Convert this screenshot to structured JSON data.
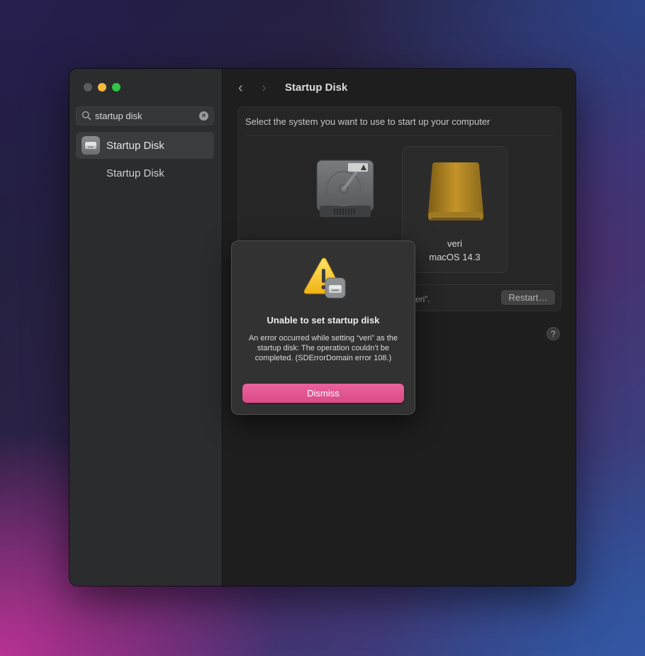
{
  "window": {
    "search": {
      "value": "startup disk"
    },
    "sidebar": {
      "items": [
        {
          "label": "Startup Disk"
        },
        {
          "label": "Startup Disk"
        }
      ]
    },
    "toolbar": {
      "title": "Startup Disk"
    },
    "panel": {
      "prompt": "Select the system you want to use to start up your computer",
      "disks": [
        {
          "icon": "internal-hdd-icon",
          "name": "",
          "os": ""
        },
        {
          "icon": "external-drive-icon",
          "name": "veri",
          "os": "macOS 14.3",
          "selected": true
        }
      ],
      "status_fragment": "eri”.",
      "restart_label": "Restart…"
    },
    "help_label": "?"
  },
  "dialog": {
    "title": "Unable to set startup disk",
    "message": "An error occurred while setting “veri” as the startup disk: The operation couldn’t be completed. (SDErrorDomain error 108.)",
    "dismiss_label": "Dismiss",
    "icon": "warning-icon"
  },
  "colors": {
    "accent": "#e0558f",
    "traffic_close": "#5b5b5b",
    "traffic_min": "#f6b93b",
    "traffic_max": "#2fc444"
  }
}
